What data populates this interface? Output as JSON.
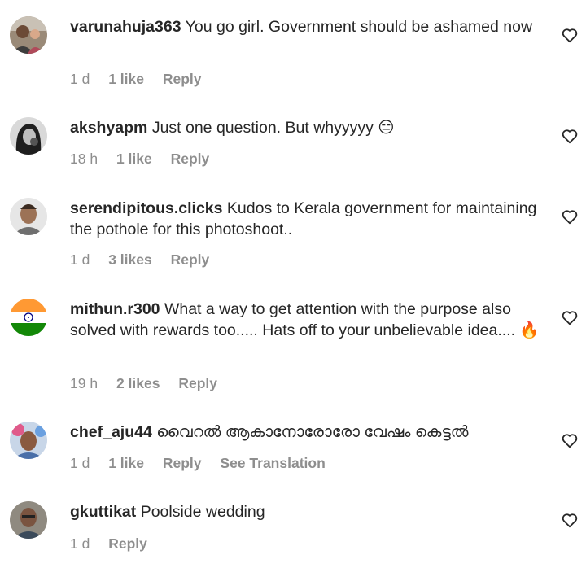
{
  "comments": [
    {
      "username": "varunahuja363",
      "text": "You go girl. Government should be ashamed now",
      "time": "1 d",
      "likes": "1 like",
      "reply": "Reply",
      "avatar_icon": "person-photo-icon"
    },
    {
      "username": "akshyapm",
      "text": "Just one question. But whyyyyy 😑",
      "time": "18 h",
      "likes": "1 like",
      "reply": "Reply",
      "avatar_icon": "person-photo-icon"
    },
    {
      "username": "serendipitous.clicks",
      "text": "Kudos to Kerala government for maintaining the pothole for this photoshoot..",
      "time": "1 d",
      "likes": "3 likes",
      "reply": "Reply",
      "avatar_icon": "person-photo-icon"
    },
    {
      "username": "mithun.r300",
      "text": "What a way to get attention with the purpose also solved with rewards too..... Hats off to your unbelievable idea.... 🔥",
      "time": "19 h",
      "likes": "2 likes",
      "reply": "Reply",
      "avatar_icon": "india-flag-icon"
    },
    {
      "username": "chef_aju44",
      "text": "വൈറൽ ആകാനോരോരോ വേഷം കെട്ടൽ",
      "time": "1 d",
      "likes": "1 like",
      "reply": "Reply",
      "see_translation": "See Translation",
      "avatar_icon": "person-photo-icon"
    },
    {
      "username": "gkuttikat",
      "text": "Poolside wedding",
      "time": "1 d",
      "reply": "Reply",
      "avatar_icon": "person-photo-icon"
    }
  ],
  "colors": {
    "text": "#262626",
    "secondary": "#8e8e8e",
    "background": "#ffffff"
  }
}
